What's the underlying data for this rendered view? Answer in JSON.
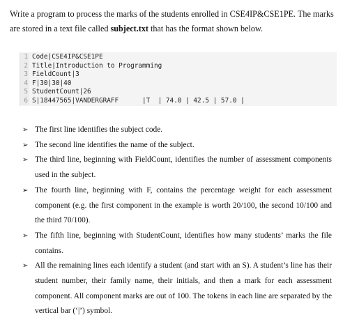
{
  "intro": {
    "line1": "Write a program to process the marks of the students enrolled in CSE4IP&CSE1PE. The marks",
    "line2_pre": "are stored in a text file called ",
    "line2_file": "subject.txt",
    "line2_post": " that has the format shown below."
  },
  "code": {
    "lines": [
      {
        "num": "1",
        "text": "Code|CSE4IP&CSE1PE"
      },
      {
        "num": "2",
        "text": "Title|Introduction to Programming"
      },
      {
        "num": "3",
        "text": "FieldCount|3"
      },
      {
        "num": "4",
        "text": "F|30|30|40"
      },
      {
        "num": "5",
        "text": "StudentCount|26"
      },
      {
        "num": "6",
        "text": "S|18447565|VANDERGRAFF      |T  | 74.0 | 42.5 | 57.0 |"
      }
    ]
  },
  "bullets": [
    "The first line identifies the subject code.",
    "The second line identifies the name of the subject.",
    "The third line, beginning with FieldCount, identifies the number of assessment components used in the subject.",
    "The fourth line, beginning with F, contains the percentage weight for each assessment component (e.g. the first component in the example is worth 20/100, the second 10/100 and the third 70/100).",
    "The fifth line, beginning with StudentCount, identifies how many students’ marks the file contains.",
    "All the remaining lines each identify a student (and start with an S). A student’s line has their student number, their family name, their initials, and then a mark for each assessment component. All component marks are out of 100. The tokens in each line are separated by the vertical bar (‘|’) symbol."
  ],
  "icons": {
    "bullet": "arrow-bullet-icon"
  }
}
